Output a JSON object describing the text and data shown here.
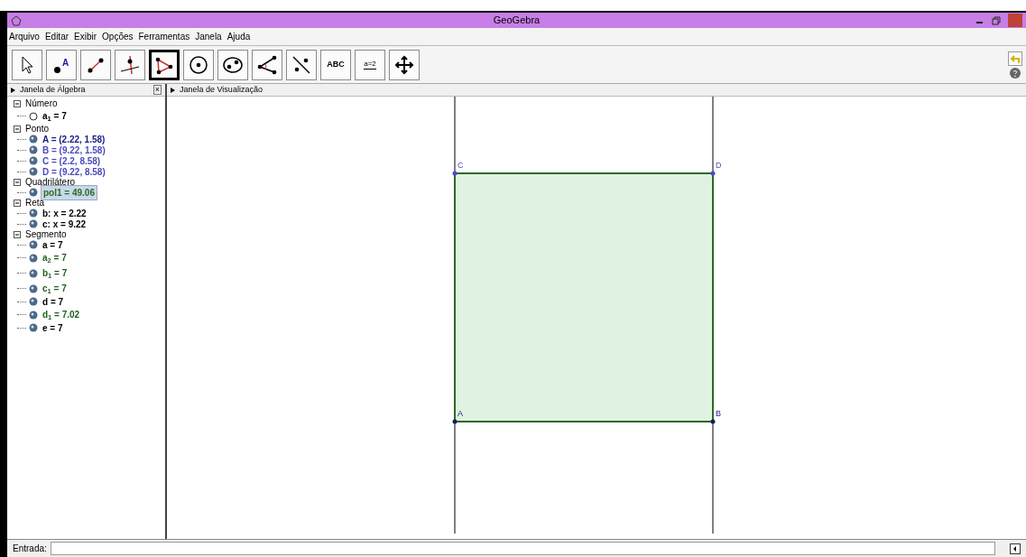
{
  "window": {
    "title": "GeoGebra"
  },
  "menu": [
    "Arquivo",
    "Editar",
    "Exibir",
    "Opções",
    "Ferramentas",
    "Janela",
    "Ajuda"
  ],
  "toolbar": [
    {
      "kind": "move",
      "selected": false
    },
    {
      "kind": "point",
      "label": "A",
      "selected": false
    },
    {
      "kind": "line",
      "selected": false
    },
    {
      "kind": "perpendicular",
      "selected": false
    },
    {
      "kind": "polygon",
      "selected": true
    },
    {
      "kind": "circle",
      "selected": false
    },
    {
      "kind": "conic",
      "selected": false
    },
    {
      "kind": "angle",
      "selected": false
    },
    {
      "kind": "reflect",
      "selected": false
    },
    {
      "kind": "text",
      "label": "ABC",
      "selected": false
    },
    {
      "kind": "slider",
      "label": "a=2",
      "selected": false
    },
    {
      "kind": "pan",
      "selected": false
    }
  ],
  "algebra_panel": {
    "title": "Janela de Álgebra",
    "close": "×",
    "groups": [
      {
        "name": "Número",
        "items": [
          {
            "text": "a$_{1}$ = 7",
            "visible": false,
            "selected": false,
            "color": "#000000"
          }
        ]
      },
      {
        "name": "Ponto",
        "items": [
          {
            "text": "A = (2.22, 1.58)",
            "visible": true,
            "selected": false,
            "color": "#1a1a80"
          },
          {
            "text": "B = (9.22, 1.58)",
            "visible": true,
            "selected": false,
            "color": "#4b4bbd"
          },
          {
            "text": "C = (2.2, 8.58)",
            "visible": true,
            "selected": false,
            "color": "#4b4bbd"
          },
          {
            "text": "D = (9.22, 8.58)",
            "visible": true,
            "selected": false,
            "color": "#4b4bbd"
          }
        ]
      },
      {
        "name": "Quadrilátero",
        "items": [
          {
            "text": "pol1 = 49.06",
            "visible": true,
            "selected": true,
            "color": "#2e6b1e"
          }
        ]
      },
      {
        "name": "Reta",
        "items": [
          {
            "text": "b: x = 2.22",
            "visible": true,
            "selected": false,
            "color": "#000000"
          },
          {
            "text": "c: x = 9.22",
            "visible": true,
            "selected": false,
            "color": "#000000"
          }
        ]
      },
      {
        "name": "Segmento",
        "items": [
          {
            "text": "a = 7",
            "visible": true,
            "selected": false,
            "color": "#000000"
          },
          {
            "text": "a$_{2}$ = 7",
            "visible": true,
            "selected": false,
            "color": "#1f5e1f"
          },
          {
            "text": "b$_{1}$ = 7",
            "visible": true,
            "selected": false,
            "color": "#1f5e1f"
          },
          {
            "text": "c$_{1}$ = 7",
            "visible": true,
            "selected": false,
            "color": "#1f5e1f"
          },
          {
            "text": "d = 7",
            "visible": true,
            "selected": false,
            "color": "#000000"
          },
          {
            "text": "d$_{1}$ = 7.02",
            "visible": true,
            "selected": false,
            "color": "#1f5e1f"
          },
          {
            "text": "e = 7",
            "visible": true,
            "selected": false,
            "color": "#000000"
          }
        ]
      }
    ]
  },
  "graphics_panel": {
    "title": "Janela de Visualização",
    "points": [
      "C",
      "D",
      "A",
      "B"
    ]
  },
  "input_bar": {
    "label": "Entrada:"
  }
}
